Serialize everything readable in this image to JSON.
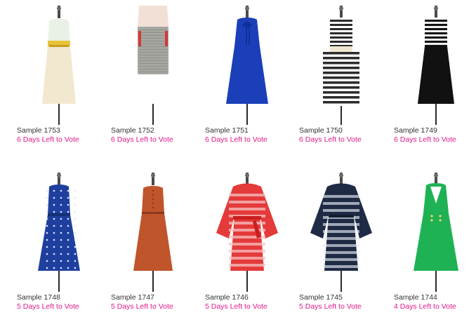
{
  "products": [
    {
      "sample": "Sample 1753",
      "votes": "6 Days Left to Vote",
      "style": "cream-tank",
      "main": "#f1e8cf",
      "accent": "#e8c23a",
      "top": "#e9f1e6"
    },
    {
      "sample": "Sample 1752",
      "votes": "6 Days Left to Vote",
      "style": "skirt",
      "main": "#a7a7a2",
      "accent": "#d23a3a",
      "top": "#f2e0d7"
    },
    {
      "sample": "Sample 1751",
      "votes": "6 Days Left to Vote",
      "style": "blue-bow",
      "main": "#1b3fb8",
      "accent": "#0f2f9a",
      "top": "#1b3fb8"
    },
    {
      "sample": "Sample 1750",
      "votes": "6 Days Left to Vote",
      "style": "stripe-belt",
      "main": "#2b2b2b",
      "accent": "#efe6d0",
      "top": "#2b2b2b"
    },
    {
      "sample": "Sample 1749",
      "votes": "6 Days Left to Vote",
      "style": "stripe-top-black",
      "main": "#111111",
      "accent": "#f2f2f2",
      "top": "#111111"
    },
    {
      "sample": "Sample 1748",
      "votes": "5 Days Left to Vote",
      "style": "blue-dots",
      "main": "#1e3f9e",
      "accent": "#dfe6ff",
      "top": "#1e3f9e"
    },
    {
      "sample": "Sample 1747",
      "votes": "5 Days Left to Vote",
      "style": "rust",
      "main": "#c0542a",
      "accent": "#8a3a1f",
      "top": "#c0542a"
    },
    {
      "sample": "Sample 1746",
      "votes": "5 Days Left to Vote",
      "style": "red-kimono",
      "main": "#e43a3a",
      "accent": "#f7c2c2",
      "top": "#e43a3a"
    },
    {
      "sample": "Sample 1745",
      "votes": "5 Days Left to Vote",
      "style": "navy-kimono",
      "main": "#1f2a44",
      "accent": "#e6edf6",
      "top": "#1f2a44"
    },
    {
      "sample": "Sample 1744",
      "votes": "4 Days Left to Vote",
      "style": "green-v",
      "main": "#1fb255",
      "accent": "#f3d56a",
      "top": "#1fb255"
    }
  ]
}
